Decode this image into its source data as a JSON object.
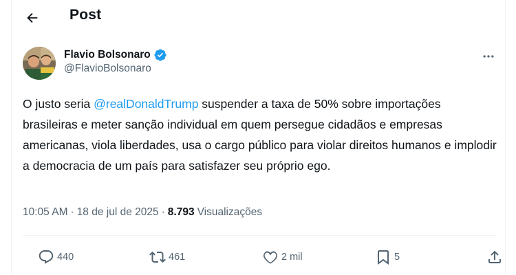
{
  "header": {
    "title": "Post",
    "back_icon": "arrow-left-icon"
  },
  "author": {
    "display_name": "Flavio Bolsonaro",
    "handle": "@FlavioBolsonaro",
    "verified_color": "#1d9bf0"
  },
  "tweet": {
    "text_before": "O justo seria ",
    "mention": "@realDonaldTrump",
    "text_after": " suspender a taxa de 50% sobre importações brasileiras e meter sanção individual em quem persegue cidadãos e empresas americanas, viola liberdades, usa o cargo público para violar direitos humanos e implodir a democracia de um país para satisfazer seu próprio ego.",
    "time": "10:05 AM",
    "date": "18 de jul de 2025",
    "views_count": "8.793",
    "views_label": "Visualizações"
  },
  "actions": {
    "replies": "440",
    "reposts": "461",
    "likes": "2 mil",
    "bookmarks": "5"
  },
  "colors": {
    "accent": "#1d9bf0",
    "secondary_text": "#536471",
    "primary_text": "#0f1419"
  }
}
